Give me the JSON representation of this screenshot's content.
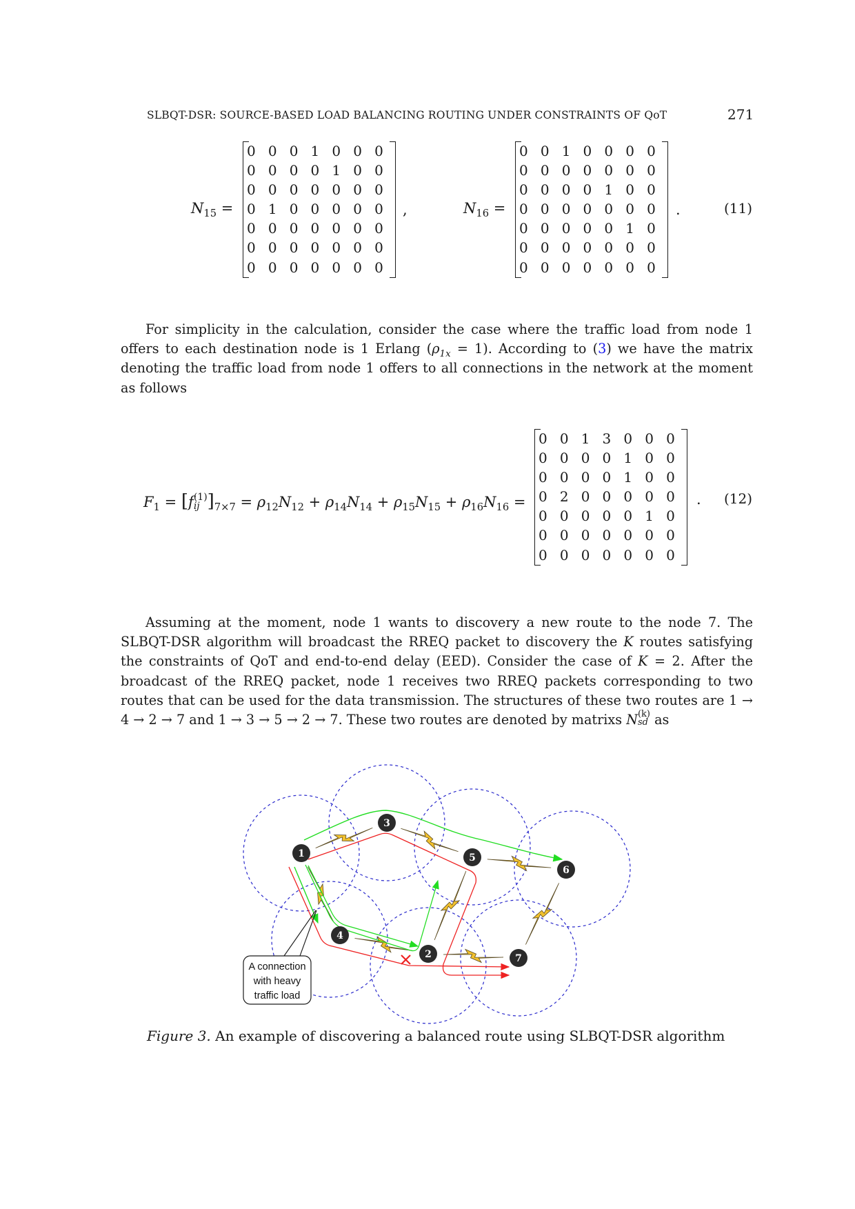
{
  "header": {
    "running_title": "SLBQT-DSR: SOURCE-BASED LOAD BALANCING ROUTING UNDER CONSTRAINTS OF QoT",
    "page_number": "271"
  },
  "equation_11": {
    "label": "(11)",
    "left": {
      "name": "N",
      "subscript": "15",
      "trailing": ",",
      "matrix": [
        [
          0,
          0,
          0,
          1,
          0,
          0,
          0
        ],
        [
          0,
          0,
          0,
          0,
          1,
          0,
          0
        ],
        [
          0,
          0,
          0,
          0,
          0,
          0,
          0
        ],
        [
          0,
          1,
          0,
          0,
          0,
          0,
          0
        ],
        [
          0,
          0,
          0,
          0,
          0,
          0,
          0
        ],
        [
          0,
          0,
          0,
          0,
          0,
          0,
          0
        ],
        [
          0,
          0,
          0,
          0,
          0,
          0,
          0
        ]
      ]
    },
    "right": {
      "name": "N",
      "subscript": "16",
      "trailing": ".",
      "matrix": [
        [
          0,
          0,
          1,
          0,
          0,
          0,
          0
        ],
        [
          0,
          0,
          0,
          0,
          0,
          0,
          0
        ],
        [
          0,
          0,
          0,
          0,
          1,
          0,
          0
        ],
        [
          0,
          0,
          0,
          0,
          0,
          0,
          0
        ],
        [
          0,
          0,
          0,
          0,
          0,
          1,
          0
        ],
        [
          0,
          0,
          0,
          0,
          0,
          0,
          0
        ],
        [
          0,
          0,
          0,
          0,
          0,
          0,
          0
        ]
      ]
    }
  },
  "paragraph_1": {
    "text_a": "For simplicity in the calculation, consider the case where the traffic load from node 1 offers to each destination node is 1 Erlang (",
    "rho": "ρ",
    "rho_sub": "1x",
    "text_b": " = 1). According to (",
    "ref": "3",
    "text_c": ") we have the matrix denoting the traffic load from node 1 offers to all connections in the network at the moment as follows"
  },
  "equation_12": {
    "label": "(12)",
    "lhs": {
      "F": "F",
      "F_sub": "1",
      "eq1": " = ",
      "f": "f",
      "f_sup": "(1)",
      "f_sub": "ij",
      "dim_sub": "7×7",
      "eq2": " = ",
      "terms": [
        {
          "rho_sub": "12",
          "N_sub": "12",
          "op": " + "
        },
        {
          "rho_sub": "14",
          "N_sub": "14",
          "op": " + "
        },
        {
          "rho_sub": "15",
          "N_sub": "15",
          "op": " + "
        },
        {
          "rho_sub": "16",
          "N_sub": "16",
          "op": " = "
        }
      ]
    },
    "trailing": ".",
    "matrix": [
      [
        0,
        0,
        1,
        3,
        0,
        0,
        0
      ],
      [
        0,
        0,
        0,
        0,
        1,
        0,
        0
      ],
      [
        0,
        0,
        0,
        0,
        1,
        0,
        0
      ],
      [
        0,
        2,
        0,
        0,
        0,
        0,
        0
      ],
      [
        0,
        0,
        0,
        0,
        0,
        1,
        0
      ],
      [
        0,
        0,
        0,
        0,
        0,
        0,
        0
      ],
      [
        0,
        0,
        0,
        0,
        0,
        0,
        0
      ]
    ]
  },
  "paragraph_2": {
    "text_a": "Assuming at the moment, node 1 wants to discovery a new route to the node 7. The SLBQT-DSR algorithm will broadcast the RREQ packet to discovery the ",
    "K1": "K",
    "text_b": " routes satisfying the constraints of QoT and end-to-end delay (EED). Consider the case of ",
    "K2": "K",
    "text_c": " = 2. After the broadcast of the RREQ packet, node 1 receives two RREQ packets corresponding to two routes that can be used for the data transmission. The structures of these two routes are 1 → 4 → 2 → 7 and 1 → 3 → 5 → 2 → 7. These two routes are denoted by matrixs ",
    "N": "N",
    "N_sup": "(k)",
    "N_sub": "sd",
    "text_d": " as"
  },
  "figure": {
    "caption_label": "Figure 3.",
    "caption_text": " An example of discovering a balanced route using SLBQT-DSR algorithm",
    "callout_lines": [
      "A connection",
      "with heavy",
      "traffic load"
    ],
    "nodes": [
      {
        "id": "1"
      },
      {
        "id": "2"
      },
      {
        "id": "3"
      },
      {
        "id": "4"
      },
      {
        "id": "5"
      },
      {
        "id": "6"
      },
      {
        "id": "7"
      }
    ],
    "colors": {
      "range_circle": "#2a2acc",
      "green_route": "#22dd22",
      "red_route": "#ee2222",
      "node_fill": "#2b2b2b",
      "bolt_fill": "#f2c12e"
    },
    "routes": {
      "green": [
        "1 → 3 → 5 → 6",
        "1 → 4 → 2",
        "2 → 5"
      ],
      "red": [
        "1 → 3 → 5 → 2 → 7",
        "1 → 4 → 2 → 7 (blocked ×)"
      ]
    }
  }
}
